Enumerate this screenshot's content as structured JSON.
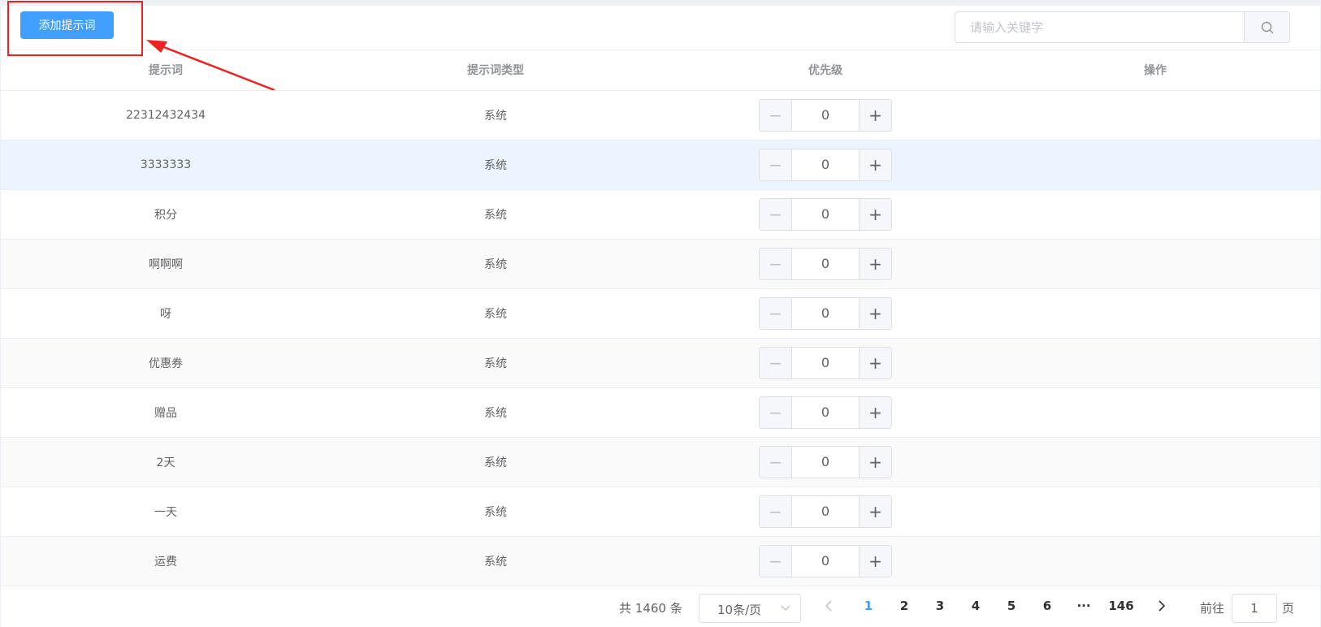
{
  "toolbar": {
    "add_button": "添加提示词",
    "search_placeholder": "请输入关键字",
    "search_icon": "search-icon"
  },
  "table": {
    "columns": [
      "提示词",
      "提示词类型",
      "优先级",
      "操作"
    ],
    "rows": [
      {
        "keyword": "22312432434",
        "type": "系统",
        "priority": "0"
      },
      {
        "keyword": "3333333",
        "type": "系统",
        "priority": "0"
      },
      {
        "keyword": "积分",
        "type": "系统",
        "priority": "0"
      },
      {
        "keyword": "啊啊啊",
        "type": "系统",
        "priority": "0"
      },
      {
        "keyword": "呀",
        "type": "系统",
        "priority": "0"
      },
      {
        "keyword": "优惠券",
        "type": "系统",
        "priority": "0"
      },
      {
        "keyword": "赠品",
        "type": "系统",
        "priority": "0"
      },
      {
        "keyword": "2天",
        "type": "系统",
        "priority": "0"
      },
      {
        "keyword": "一天",
        "type": "系统",
        "priority": "0"
      },
      {
        "keyword": "运费",
        "type": "系统",
        "priority": "0"
      }
    ],
    "minus_symbol": "−",
    "plus_symbol": "+"
  },
  "pagination": {
    "total": "共 1460 条",
    "page_size": "10条/页",
    "pages": [
      "1",
      "2",
      "3",
      "4",
      "5",
      "6"
    ],
    "ellipsis": "···",
    "last_page": "146",
    "current_page": "1",
    "goto_label": "前往",
    "goto_value": "1",
    "page_unit": "页"
  },
  "colors": {
    "primary": "#409eff",
    "annotation": "#f02020"
  }
}
